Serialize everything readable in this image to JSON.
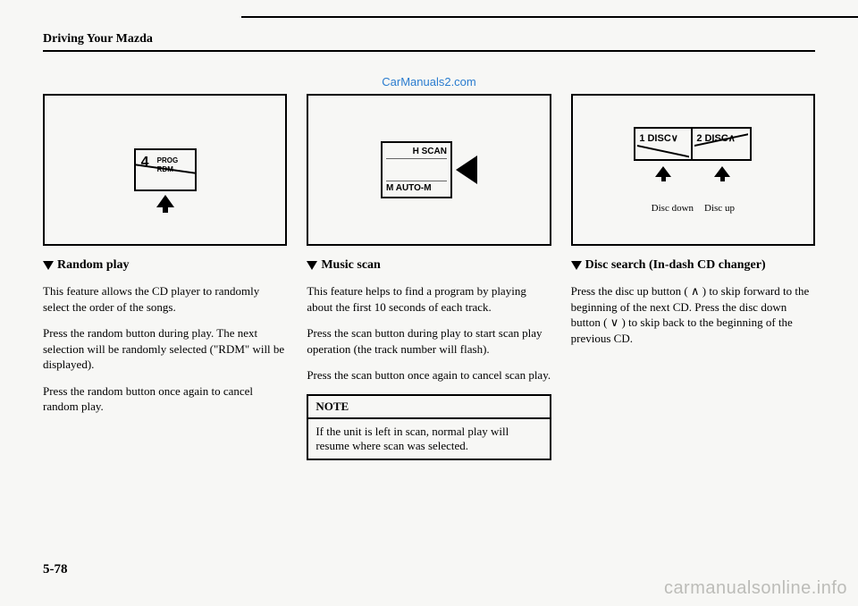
{
  "header": {
    "section_title": "Driving Your Mazda"
  },
  "watermark_top": "CarManuals2.com",
  "col1": {
    "button": {
      "num": "4",
      "line1": "PROG",
      "line2": "RDM"
    },
    "title": "Random play",
    "p1": "This feature allows the CD player to randomly select the order of the songs.",
    "p2": "Press the random button during play. The next selection will be randomly selected (\"RDM\" will be displayed).",
    "p3": "Press the random button once again to cancel random play."
  },
  "col2": {
    "button": {
      "top": "H SCAN",
      "bottom": "M AUTO-M"
    },
    "title": "Music scan",
    "p1": "This feature helps to find a program by playing about the first 10 seconds of each track.",
    "p2": "Press the scan button during play to start scan play operation (the track number will flash).",
    "p3": "Press the scan button once again to cancel scan play.",
    "note_head": "NOTE",
    "note_body": "If the unit is left in scan, normal play will resume where scan was selected."
  },
  "col3": {
    "button1": "1 DISC∨",
    "button2": "2 DISC∧",
    "cap1": "Disc down",
    "cap2": "Disc up",
    "title": "Disc search (In-dash CD changer)",
    "p1": "Press the disc up button ( ∧ ) to skip forward to the beginning of the next CD. Press the disc down button ( ∨ ) to skip back to the beginning of the previous CD."
  },
  "page_number": "5-78",
  "watermark_bottom": "carmanualsonline.info"
}
